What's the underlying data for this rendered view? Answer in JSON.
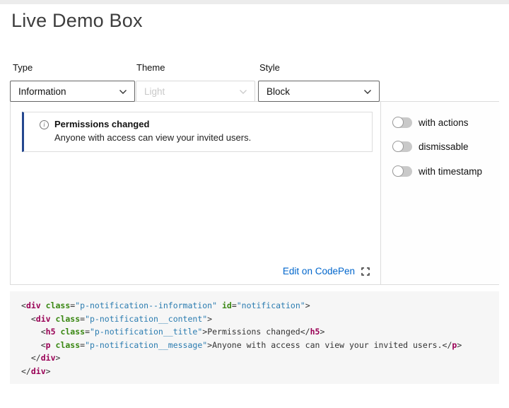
{
  "page": {
    "title": "Live Demo Box"
  },
  "controls": {
    "selects": [
      {
        "label": "Type",
        "value": "Information",
        "disabled": false
      },
      {
        "label": "Theme",
        "value": "Light",
        "disabled": true
      },
      {
        "label": "Style",
        "value": "Block",
        "disabled": false
      }
    ]
  },
  "demo": {
    "notification": {
      "icon": "information-icon",
      "title": "Permissions changed",
      "message": "Anyone with access can view your invited users.",
      "accent_color": "#24478f"
    },
    "codepen": {
      "label": "Edit on CodePen",
      "link_color": "#0066cc",
      "icon": "external-link-icon"
    }
  },
  "toggles": [
    {
      "label": "with actions",
      "state": "off"
    },
    {
      "label": "dismissable",
      "state": "off"
    },
    {
      "label": "with timestamp",
      "state": "off"
    }
  ],
  "code": {
    "language": "html",
    "background": "#f6f6f6",
    "colors": {
      "t": "#990055",
      "a": "#398712",
      "s": "#2b7cb0",
      "p": "#333333",
      "x": "#333333"
    },
    "lines": [
      [
        [
          "p",
          "<"
        ],
        [
          "t",
          "div"
        ],
        [
          "x",
          " "
        ],
        [
          "a",
          "class"
        ],
        [
          "p",
          "="
        ],
        [
          "s",
          "\"p-notification--information\""
        ],
        [
          "x",
          " "
        ],
        [
          "a",
          "id"
        ],
        [
          "p",
          "="
        ],
        [
          "s",
          "\"notification\""
        ],
        [
          "p",
          ">"
        ]
      ],
      [
        [
          "x",
          "  "
        ],
        [
          "p",
          "<"
        ],
        [
          "t",
          "div"
        ],
        [
          "x",
          " "
        ],
        [
          "a",
          "class"
        ],
        [
          "p",
          "="
        ],
        [
          "s",
          "\"p-notification__content\""
        ],
        [
          "p",
          ">"
        ]
      ],
      [
        [
          "x",
          "    "
        ],
        [
          "p",
          "<"
        ],
        [
          "t",
          "h5"
        ],
        [
          "x",
          " "
        ],
        [
          "a",
          "class"
        ],
        [
          "p",
          "="
        ],
        [
          "s",
          "\"p-notification__title\""
        ],
        [
          "p",
          ">"
        ],
        [
          "x",
          "Permissions changed"
        ],
        [
          "p",
          "</"
        ],
        [
          "t",
          "h5"
        ],
        [
          "p",
          ">"
        ]
      ],
      [
        [
          "x",
          "    "
        ],
        [
          "p",
          "<"
        ],
        [
          "t",
          "p"
        ],
        [
          "x",
          " "
        ],
        [
          "a",
          "class"
        ],
        [
          "p",
          "="
        ],
        [
          "s",
          "\"p-notification__message\""
        ],
        [
          "p",
          ">"
        ],
        [
          "x",
          "Anyone with access can view your invited users."
        ],
        [
          "p",
          "</"
        ],
        [
          "t",
          "p"
        ],
        [
          "p",
          ">"
        ]
      ],
      [
        [
          "x",
          "  "
        ],
        [
          "p",
          "</"
        ],
        [
          "t",
          "div"
        ],
        [
          "p",
          ">"
        ]
      ],
      [
        [
          "p",
          "</"
        ],
        [
          "t",
          "div"
        ],
        [
          "p",
          ">"
        ]
      ]
    ]
  }
}
